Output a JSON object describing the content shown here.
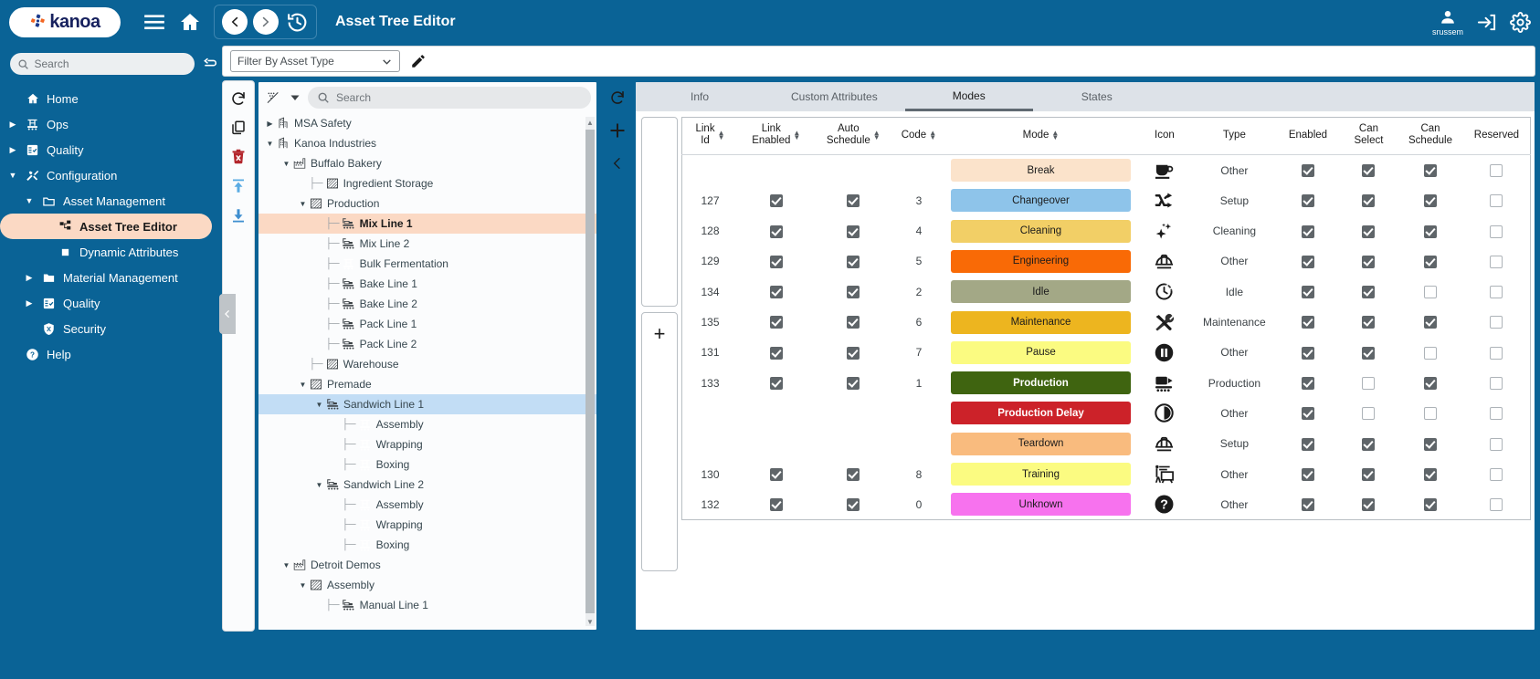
{
  "topbar": {
    "logo_text": "kanoa",
    "page_title": "Asset Tree Editor",
    "user_name": "srussem",
    "icons": {
      "hamburger": "hamburger-icon",
      "home": "home-icon",
      "back": "back-icon",
      "forward": "forward-icon",
      "history": "history-icon",
      "account": "account-icon",
      "logout": "logout-icon",
      "settings": "settings-icon"
    }
  },
  "sidebar": {
    "search_placeholder": "Search",
    "items": [
      {
        "label": "Home",
        "level": 1,
        "arrow": "",
        "icon": "home-icon",
        "selected": false
      },
      {
        "label": "Ops",
        "level": 1,
        "arrow": "▶",
        "icon": "conveyor-icon",
        "selected": false
      },
      {
        "label": "Quality",
        "level": 1,
        "arrow": "▶",
        "icon": "clipboard-icon",
        "selected": false
      },
      {
        "label": "Configuration",
        "level": 1,
        "arrow": "▼",
        "icon": "tools-icon",
        "selected": false
      },
      {
        "label": "Asset Management",
        "level": 2,
        "arrow": "▼",
        "icon": "folder-icon",
        "selected": false
      },
      {
        "label": "Asset Tree Editor",
        "level": 3,
        "arrow": "",
        "icon": "tree-icon",
        "selected": true
      },
      {
        "label": "Dynamic Attributes",
        "level": 3,
        "arrow": "",
        "icon": "square-icon",
        "selected": false
      },
      {
        "label": "Material Management",
        "level": 2,
        "arrow": "▶",
        "icon": "folder-filled-icon",
        "selected": false
      },
      {
        "label": "Quality",
        "level": 2,
        "arrow": "▶",
        "icon": "clipboard-icon",
        "selected": false
      },
      {
        "label": "Security",
        "level": 2,
        "arrow": "",
        "icon": "shield-icon",
        "selected": false
      },
      {
        "label": "Help",
        "level": 1,
        "arrow": "",
        "icon": "help-icon",
        "selected": false
      }
    ]
  },
  "filterbar": {
    "select_value": "Filter By Asset Type",
    "edit_icon": "pencil-icon"
  },
  "tree_toolbar": {
    "buttons": [
      "refresh-icon",
      "copy-icon",
      "delete-icon",
      "move-up-icon",
      "move-down-icon"
    ]
  },
  "tree": {
    "search_placeholder": "Search",
    "filter_icon": "filter-off-icon",
    "dropdown_icon": "chevron-down-icon",
    "nodes": [
      {
        "label": "MSA Safety",
        "depth": 0,
        "caret": "▶",
        "icon": "building-icon",
        "select": ""
      },
      {
        "label": "Kanoa Industries",
        "depth": 0,
        "caret": "▼",
        "icon": "building-icon",
        "select": ""
      },
      {
        "label": "Buffalo Bakery",
        "depth": 1,
        "caret": "▼",
        "icon": "factory-icon",
        "select": ""
      },
      {
        "label": "Ingredient Storage",
        "depth": 2,
        "caret": "",
        "icon": "area-icon",
        "select": ""
      },
      {
        "label": "Production",
        "depth": 2,
        "caret": "▼",
        "icon": "area-icon",
        "select": ""
      },
      {
        "label": "Mix Line 1",
        "depth": 3,
        "caret": "",
        "icon": "line-icon",
        "select": "orange"
      },
      {
        "label": "Mix Line 2",
        "depth": 3,
        "caret": "",
        "icon": "line-icon",
        "select": ""
      },
      {
        "label": "Bulk Fermentation",
        "depth": 3,
        "caret": "",
        "icon": "conveyor-icon",
        "select": ""
      },
      {
        "label": "Bake Line 1",
        "depth": 3,
        "caret": "",
        "icon": "line-icon",
        "select": ""
      },
      {
        "label": "Bake Line 2",
        "depth": 3,
        "caret": "",
        "icon": "line-icon",
        "select": ""
      },
      {
        "label": "Pack Line 1",
        "depth": 3,
        "caret": "",
        "icon": "line-icon",
        "select": ""
      },
      {
        "label": "Pack Line 2",
        "depth": 3,
        "caret": "",
        "icon": "line-icon",
        "select": ""
      },
      {
        "label": "Warehouse",
        "depth": 2,
        "caret": "",
        "icon": "area-icon",
        "select": ""
      },
      {
        "label": "Premade",
        "depth": 2,
        "caret": "▼",
        "icon": "area-icon",
        "select": ""
      },
      {
        "label": "Sandwich Line 1",
        "depth": 3,
        "caret": "▼",
        "icon": "line-icon",
        "select": "blue"
      },
      {
        "label": "Assembly",
        "depth": 4,
        "caret": "",
        "icon": "conveyor-icon",
        "select": ""
      },
      {
        "label": "Wrapping",
        "depth": 4,
        "caret": "",
        "icon": "conveyor-icon",
        "select": ""
      },
      {
        "label": "Boxing",
        "depth": 4,
        "caret": "",
        "icon": "conveyor-icon",
        "select": ""
      },
      {
        "label": "Sandwich Line 2",
        "depth": 3,
        "caret": "▼",
        "icon": "line-icon",
        "select": ""
      },
      {
        "label": "Assembly",
        "depth": 4,
        "caret": "",
        "icon": "conveyor-icon",
        "select": ""
      },
      {
        "label": "Wrapping",
        "depth": 4,
        "caret": "",
        "icon": "conveyor-icon",
        "select": ""
      },
      {
        "label": "Boxing",
        "depth": 4,
        "caret": "",
        "icon": "conveyor-icon",
        "select": ""
      },
      {
        "label": "Detroit Demos",
        "depth": 1,
        "caret": "▼",
        "icon": "factory-icon",
        "select": ""
      },
      {
        "label": "Assembly",
        "depth": 2,
        "caret": "▼",
        "icon": "area-icon",
        "select": ""
      },
      {
        "label": "Manual Line 1",
        "depth": 3,
        "caret": "",
        "icon": "line-icon",
        "select": ""
      }
    ]
  },
  "midbar": {
    "buttons": [
      "refresh-icon",
      "add-icon",
      "collapse-left-icon"
    ]
  },
  "content": {
    "tabs": [
      {
        "label": "Info",
        "active": false
      },
      {
        "label": "Custom Attributes",
        "active": false
      },
      {
        "label": "Modes",
        "active": true
      },
      {
        "label": "States",
        "active": false
      }
    ],
    "add_row_icon": "plus-icon",
    "table": {
      "columns": [
        {
          "lines": [
            "Link",
            "Id"
          ],
          "sortable": true
        },
        {
          "lines": [
            "Link",
            "Enabled"
          ],
          "sortable": true
        },
        {
          "lines": [
            "Auto",
            "Schedule"
          ],
          "sortable": true
        },
        {
          "lines": [
            "Code"
          ],
          "sortable": true
        },
        {
          "lines": [
            "Mode"
          ],
          "sortable": true
        },
        {
          "lines": [
            "Icon"
          ],
          "sortable": false
        },
        {
          "lines": [
            "Type"
          ],
          "sortable": false
        },
        {
          "lines": [
            "Enabled"
          ],
          "sortable": false
        },
        {
          "lines": [
            "Can",
            "Select"
          ],
          "sortable": false
        },
        {
          "lines": [
            "Can",
            "Schedule"
          ],
          "sortable": false
        },
        {
          "lines": [
            "Reserved"
          ],
          "sortable": false
        }
      ],
      "rows": [
        {
          "link_id": "",
          "link_enabled": null,
          "auto_schedule": null,
          "code": "",
          "mode": "Break",
          "mode_bg": "#fbe3cb",
          "mode_fg": "#1b1b1b",
          "icon": "coffee-cup-icon",
          "type": "Other",
          "enabled": true,
          "can_select": true,
          "can_schedule": true,
          "reserved": false
        },
        {
          "link_id": "127",
          "link_enabled": true,
          "auto_schedule": true,
          "code": "3",
          "mode": "Changeover",
          "mode_bg": "#8ec4ea",
          "mode_fg": "#1b1b1b",
          "icon": "shuffle-icon",
          "type": "Setup",
          "enabled": true,
          "can_select": true,
          "can_schedule": true,
          "reserved": false
        },
        {
          "link_id": "128",
          "link_enabled": true,
          "auto_schedule": true,
          "code": "4",
          "mode": "Cleaning",
          "mode_bg": "#f2cf66",
          "mode_fg": "#1b1b1b",
          "icon": "sparkle-icon",
          "type": "Cleaning",
          "enabled": true,
          "can_select": true,
          "can_schedule": true,
          "reserved": false
        },
        {
          "link_id": "129",
          "link_enabled": true,
          "auto_schedule": true,
          "code": "5",
          "mode": "Engineering",
          "mode_bg": "#f96a06",
          "mode_fg": "#1b1b1b",
          "icon": "hardhat-icon",
          "type": "Other",
          "enabled": true,
          "can_select": true,
          "can_schedule": true,
          "reserved": false
        },
        {
          "link_id": "134",
          "link_enabled": true,
          "auto_schedule": true,
          "code": "2",
          "mode": "Idle",
          "mode_bg": "#a3a886",
          "mode_fg": "#1b1b1b",
          "icon": "clock-dashed-icon",
          "type": "Idle",
          "enabled": true,
          "can_select": true,
          "can_schedule": false,
          "reserved": false
        },
        {
          "link_id": "135",
          "link_enabled": true,
          "auto_schedule": true,
          "code": "6",
          "mode": "Maintenance",
          "mode_bg": "#edb51f",
          "mode_fg": "#1b1b1b",
          "icon": "wrench-icon",
          "type": "Maintenance",
          "enabled": true,
          "can_select": true,
          "can_schedule": true,
          "reserved": false
        },
        {
          "link_id": "131",
          "link_enabled": true,
          "auto_schedule": true,
          "code": "7",
          "mode": "Pause",
          "mode_bg": "#fbfb81",
          "mode_fg": "#1b1b1b",
          "icon": "pause-icon",
          "type": "Other",
          "enabled": true,
          "can_select": true,
          "can_schedule": false,
          "reserved": false
        },
        {
          "link_id": "133",
          "link_enabled": true,
          "auto_schedule": true,
          "code": "1",
          "mode": "Production",
          "mode_bg": "#3f6410",
          "mode_fg": "#ffffff",
          "icon": "production-icon",
          "type": "Production",
          "enabled": true,
          "can_select": false,
          "can_schedule": true,
          "reserved": false
        },
        {
          "link_id": "",
          "link_enabled": null,
          "auto_schedule": null,
          "code": "",
          "mode": "Production Delay",
          "mode_bg": "#cc2229",
          "mode_fg": "#ffffff",
          "icon": "pie-clock-icon",
          "type": "Other",
          "enabled": true,
          "can_select": false,
          "can_schedule": false,
          "reserved": false
        },
        {
          "link_id": "",
          "link_enabled": null,
          "auto_schedule": null,
          "code": "",
          "mode": "Teardown",
          "mode_bg": "#f9bb7e",
          "mode_fg": "#1b1b1b",
          "icon": "hardhat-icon",
          "type": "Setup",
          "enabled": true,
          "can_select": true,
          "can_schedule": true,
          "reserved": false
        },
        {
          "link_id": "130",
          "link_enabled": true,
          "auto_schedule": true,
          "code": "8",
          "mode": "Training",
          "mode_bg": "#fbfb81",
          "mode_fg": "#1b1b1b",
          "icon": "presentation-icon",
          "type": "Other",
          "enabled": true,
          "can_select": true,
          "can_schedule": true,
          "reserved": false
        },
        {
          "link_id": "132",
          "link_enabled": true,
          "auto_schedule": true,
          "code": "0",
          "mode": "Unknown",
          "mode_bg": "#f772ee",
          "mode_fg": "#1b1b1b",
          "icon": "question-icon",
          "type": "Other",
          "enabled": true,
          "can_select": true,
          "can_schedule": true,
          "reserved": false
        }
      ]
    }
  },
  "colors": {
    "brand_blue": "#0a6396",
    "selection_orange": "#fbd9c4",
    "selection_blue": "#c2ddf5"
  }
}
